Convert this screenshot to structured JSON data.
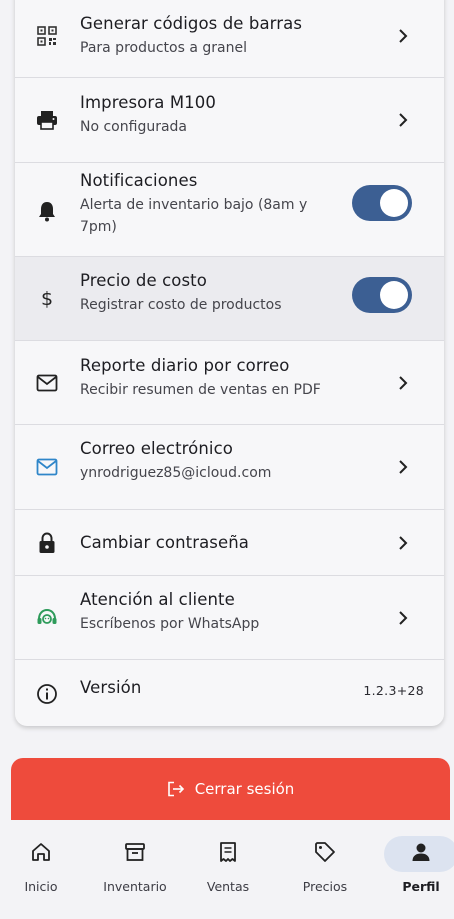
{
  "settings": {
    "items": [
      {
        "title": "Generar códigos de barras",
        "subtitle": "Para productos a granel",
        "icon": "qr-code-icon"
      },
      {
        "title": "Impresora M100",
        "subtitle": "No configurada",
        "icon": "printer-icon"
      },
      {
        "title": "Notificaciones",
        "subtitle": "Alerta de inventario bajo (8am y 7pm)",
        "icon": "bell-icon",
        "toggle_on": true
      },
      {
        "title": "Precio de costo",
        "subtitle": "Registrar costo de productos",
        "icon": "dollar-icon",
        "toggle_on": true
      },
      {
        "title": "Reporte diario por correo",
        "subtitle": "Recibir resumen de ventas en PDF",
        "icon": "mail-icon"
      },
      {
        "title": "Correo electrónico",
        "subtitle": "ynrodriguez85@icloud.com",
        "icon": "mail-blue-icon"
      },
      {
        "title": "Cambiar contraseña",
        "icon": "lock-icon"
      },
      {
        "title": "Atención al cliente",
        "subtitle": "Escríbenos por WhatsApp",
        "icon": "support-agent-icon"
      },
      {
        "title": "Versión",
        "value": "1.2.3+28",
        "icon": "info-icon"
      }
    ]
  },
  "logout": {
    "label": "Cerrar sesión",
    "icon": "logout-icon"
  },
  "nav": {
    "items": [
      {
        "label": "Inicio",
        "icon": "home-icon"
      },
      {
        "label": "Inventario",
        "icon": "archive-icon"
      },
      {
        "label": "Ventas",
        "icon": "receipt-icon"
      },
      {
        "label": "Precios",
        "icon": "tag-icon"
      },
      {
        "label": "Perfil",
        "icon": "person-icon",
        "active": true
      }
    ]
  },
  "colors": {
    "accent": "#3c5f93",
    "danger": "#ee4b3c",
    "mail_blue": "#2f86c9",
    "support_green": "#2e9b5b"
  }
}
